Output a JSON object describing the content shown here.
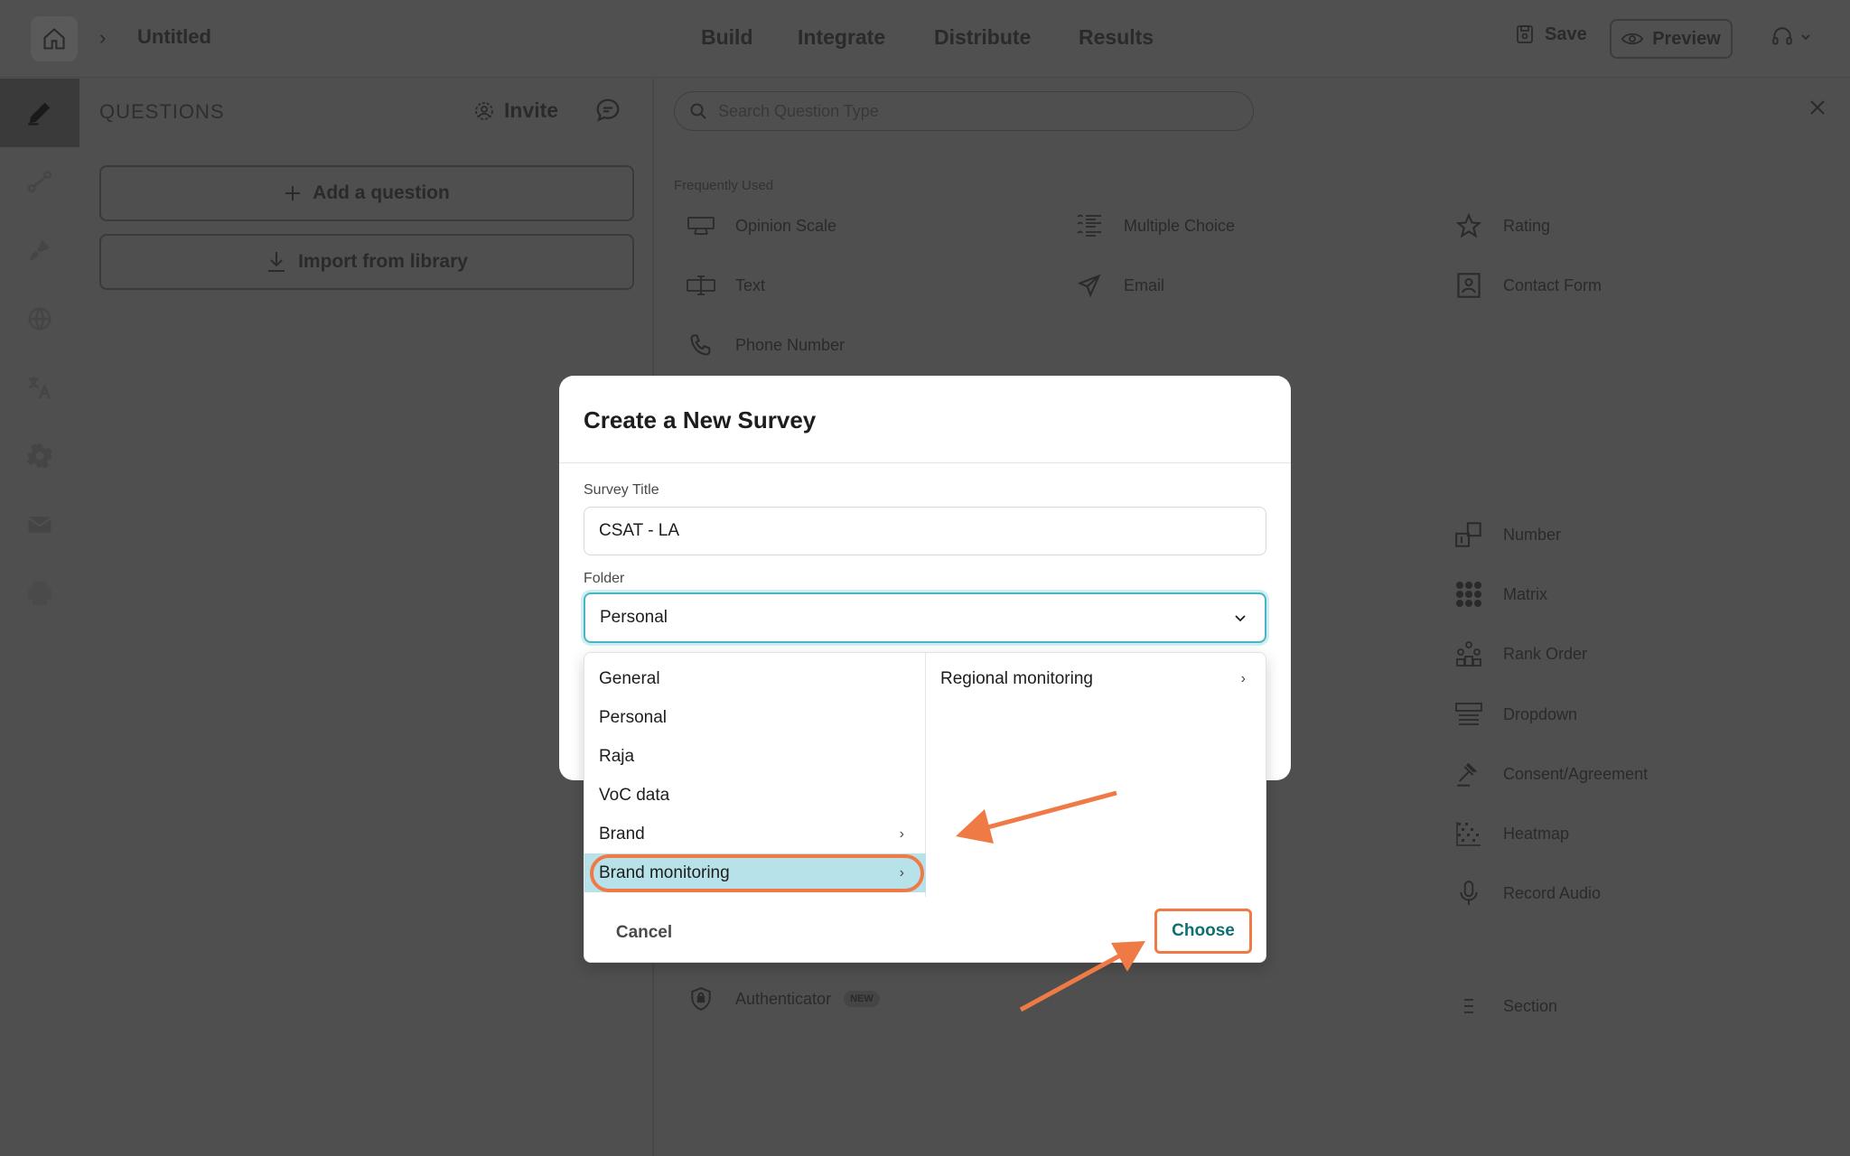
{
  "topbar": {
    "breadcrumb_chevron": "›",
    "title": "Untitled",
    "tabs": [
      "Build",
      "Integrate",
      "Distribute",
      "Results"
    ],
    "save_label": "Save",
    "preview_label": "Preview"
  },
  "questions_panel": {
    "header": "QUESTIONS",
    "invite_label": "Invite",
    "add_label": "Add a question",
    "import_label": "Import from library"
  },
  "types_panel": {
    "search_placeholder": "Search Question Type",
    "section_label": "Frequently Used",
    "types": {
      "opinion_scale": "Opinion Scale",
      "multiple_choice": "Multiple Choice",
      "rating": "Rating",
      "text": "Text",
      "email": "Email",
      "contact_form": "Contact Form",
      "phone_number": "Phone Number",
      "number": "Number",
      "matrix": "Matrix",
      "rank_order": "Rank Order",
      "dropdown": "Dropdown",
      "consent": "Consent/Agreement",
      "heatmap": "Heatmap",
      "record_audio": "Record Audio",
      "section": "Section",
      "authenticator": "Authenticator"
    },
    "new_badge": "NEW"
  },
  "modal": {
    "title": "Create a New Survey",
    "survey_title_label": "Survey Title",
    "survey_title_value": "CSAT - LA",
    "folder_label": "Folder",
    "folder_value": "Personal",
    "folders": [
      "General",
      "Personal",
      "Raja",
      "VoC data",
      "Brand",
      "Brand monitoring"
    ],
    "subfolders": [
      "Regional monitoring"
    ],
    "cancel_label": "Cancel",
    "choose_label": "Choose"
  },
  "colors": {
    "accent": "#4bb4c1",
    "selected_row": "#b8e2e9",
    "annotation": "#f07a45",
    "choose_text": "#106f72"
  }
}
